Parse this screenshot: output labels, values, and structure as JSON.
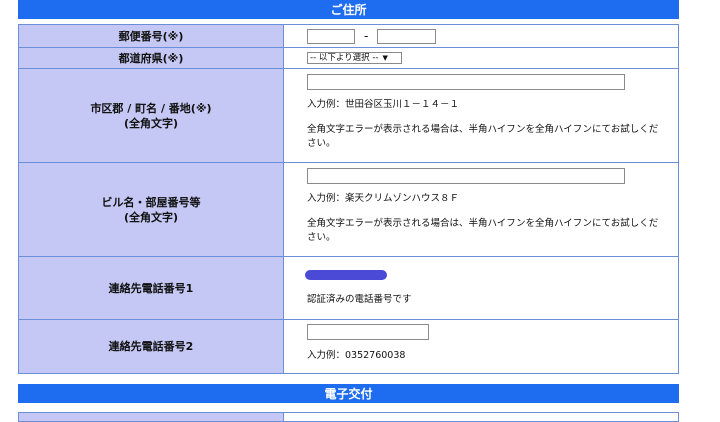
{
  "sections": {
    "address_header": "ご住所",
    "delivery_header": "電子交付"
  },
  "rows": {
    "postal": {
      "label": "郵便番号(※)",
      "first_value": "",
      "second_value": "",
      "separator": "-"
    },
    "prefecture": {
      "label": "都道府県(※)",
      "selected": "-- 以下より選択 --",
      "arrow": "▼"
    },
    "city": {
      "label_line1": "市区郡 / 町名 / 番地(※)",
      "label_line2": "(全角文字)",
      "value": "",
      "example": "入力例：世田谷区玉川１－１４－１",
      "note": "全角文字エラーが表示される場合は、半角ハイフンを全角ハイフンにてお試しください。"
    },
    "building": {
      "label_line1": "ビル名・部屋番号等",
      "label_line2": "(全角文字)",
      "value": "",
      "example": "入力例：楽天クリムゾンハウス８Ｆ",
      "note": "全角文字エラーが表示される場合は、半角ハイフンを全角ハイフンにてお試しください。"
    },
    "phone1": {
      "label": "連絡先電話番号1",
      "status": "認証済みの電話番号です"
    },
    "phone2": {
      "label": "連絡先電話番号2",
      "value": "",
      "example": "入力例：0352760038"
    }
  },
  "colors": {
    "header_bg": "#1e6df0",
    "label_bg": "#c5c8f4",
    "border": "#6a8fd8",
    "redaction": "#4a4ad6"
  }
}
